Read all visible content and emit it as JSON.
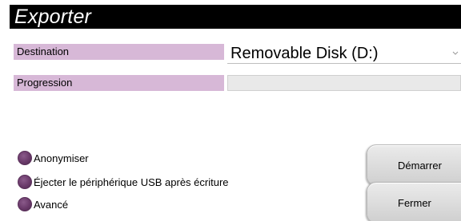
{
  "window": {
    "title": "Exporter"
  },
  "fields": {
    "destination_label": "Destination",
    "destination_value": "Removable Disk (D:)",
    "progress_label": "Progression",
    "progress_value": 0
  },
  "options": [
    {
      "label": "Anonymiser"
    },
    {
      "label": "Éjecter le périphérique USB après écriture"
    },
    {
      "label": "Avancé"
    }
  ],
  "buttons": {
    "start_label": "Démarrer",
    "close_label": "Fermer"
  },
  "colors": {
    "accent": "#d7b8d7",
    "radio": "#6a3a6a",
    "title_bar": "#000000"
  },
  "icons": {
    "dropdown": "chevron-down-icon"
  }
}
